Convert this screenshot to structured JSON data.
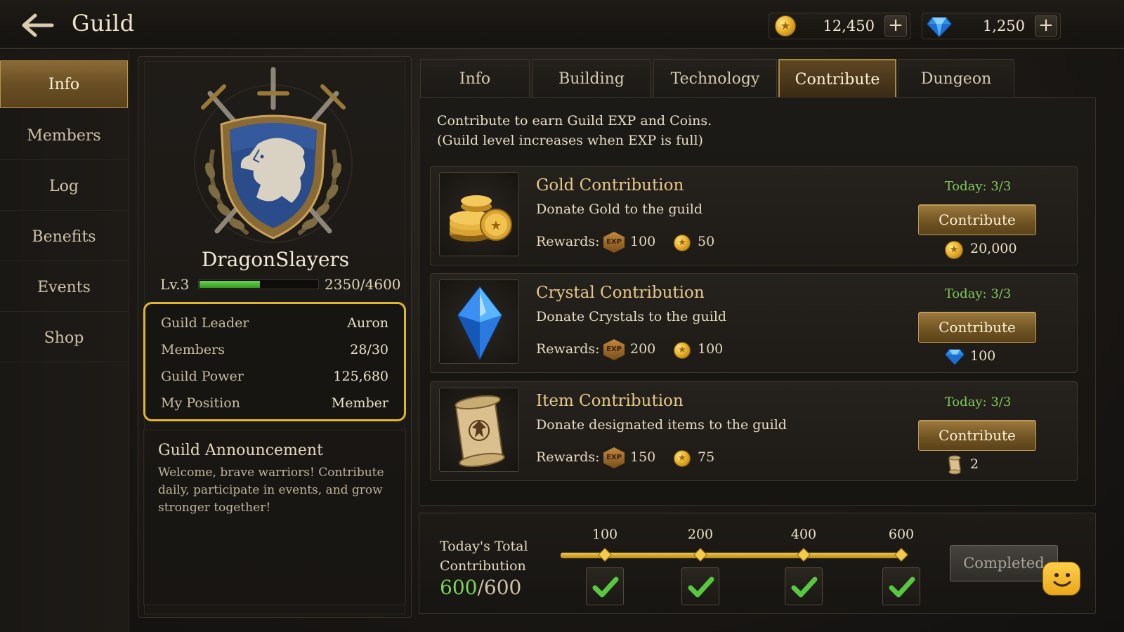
{
  "header": {
    "title": "Guild",
    "gold": "12,450",
    "gems": "1,250"
  },
  "sidebar": {
    "items": [
      {
        "label": "Info",
        "active": true
      },
      {
        "label": "Members"
      },
      {
        "label": "Log"
      },
      {
        "label": "Benefits"
      },
      {
        "label": "Events"
      },
      {
        "label": "Shop"
      }
    ]
  },
  "guild": {
    "name": "DragonSlayers",
    "level": "Lv.3",
    "exp_text": "2350/4600",
    "exp_fraction": 0.511,
    "info": [
      {
        "key": "Guild Leader",
        "value": "Auron"
      },
      {
        "key": "Members",
        "value": "28/30"
      },
      {
        "key": "Guild Power",
        "value": "125,680"
      },
      {
        "key": "My Position",
        "value": "Member"
      }
    ],
    "announcement_title": "Guild Announcement",
    "announcement_body": "Welcome, brave warriors! Contribute daily, participate in events, and grow stronger together!"
  },
  "tabs": [
    {
      "label": "Info"
    },
    {
      "label": "Building"
    },
    {
      "label": "Technology"
    },
    {
      "label": "Contribute",
      "active": true
    },
    {
      "label": "Dungeon"
    }
  ],
  "contribute": {
    "intro_line1": "Contribute to earn Guild EXP and Coins.",
    "intro_line2": "(Guild level increases when EXP is full)",
    "rewards_label": "Rewards:",
    "exp_badge": "EXP",
    "button_label": "Contribute",
    "cards": [
      {
        "title": "Gold Contribution",
        "desc": "Donate Gold to the guild",
        "exp": "100",
        "coins": "50",
        "today": "Today: 3/3",
        "cost": "20,000",
        "icon": "gold-coins-icon"
      },
      {
        "title": "Crystal Contribution",
        "desc": "Donate Crystals to the guild",
        "exp": "200",
        "coins": "100",
        "today": "Today: 3/3",
        "cost": "100",
        "icon": "blue-crystal-icon"
      },
      {
        "title": "Item Contribution",
        "desc": "Donate designated items to the guild",
        "exp": "150",
        "coins": "75",
        "today": "Today: 3/3",
        "cost": "2",
        "icon": "scroll-icon"
      }
    ]
  },
  "total": {
    "label_line1": "Today's Total",
    "label_line2": "Contribution",
    "current": "600",
    "max": "/600",
    "milestones": [
      "100",
      "200",
      "400",
      "600"
    ],
    "completed_label": "Completed"
  },
  "colors": {
    "accent_gold": "#e0b62c",
    "progress_green": "#4fbf36",
    "today_green": "#7cc85a",
    "card_title": "#e6c88a"
  }
}
